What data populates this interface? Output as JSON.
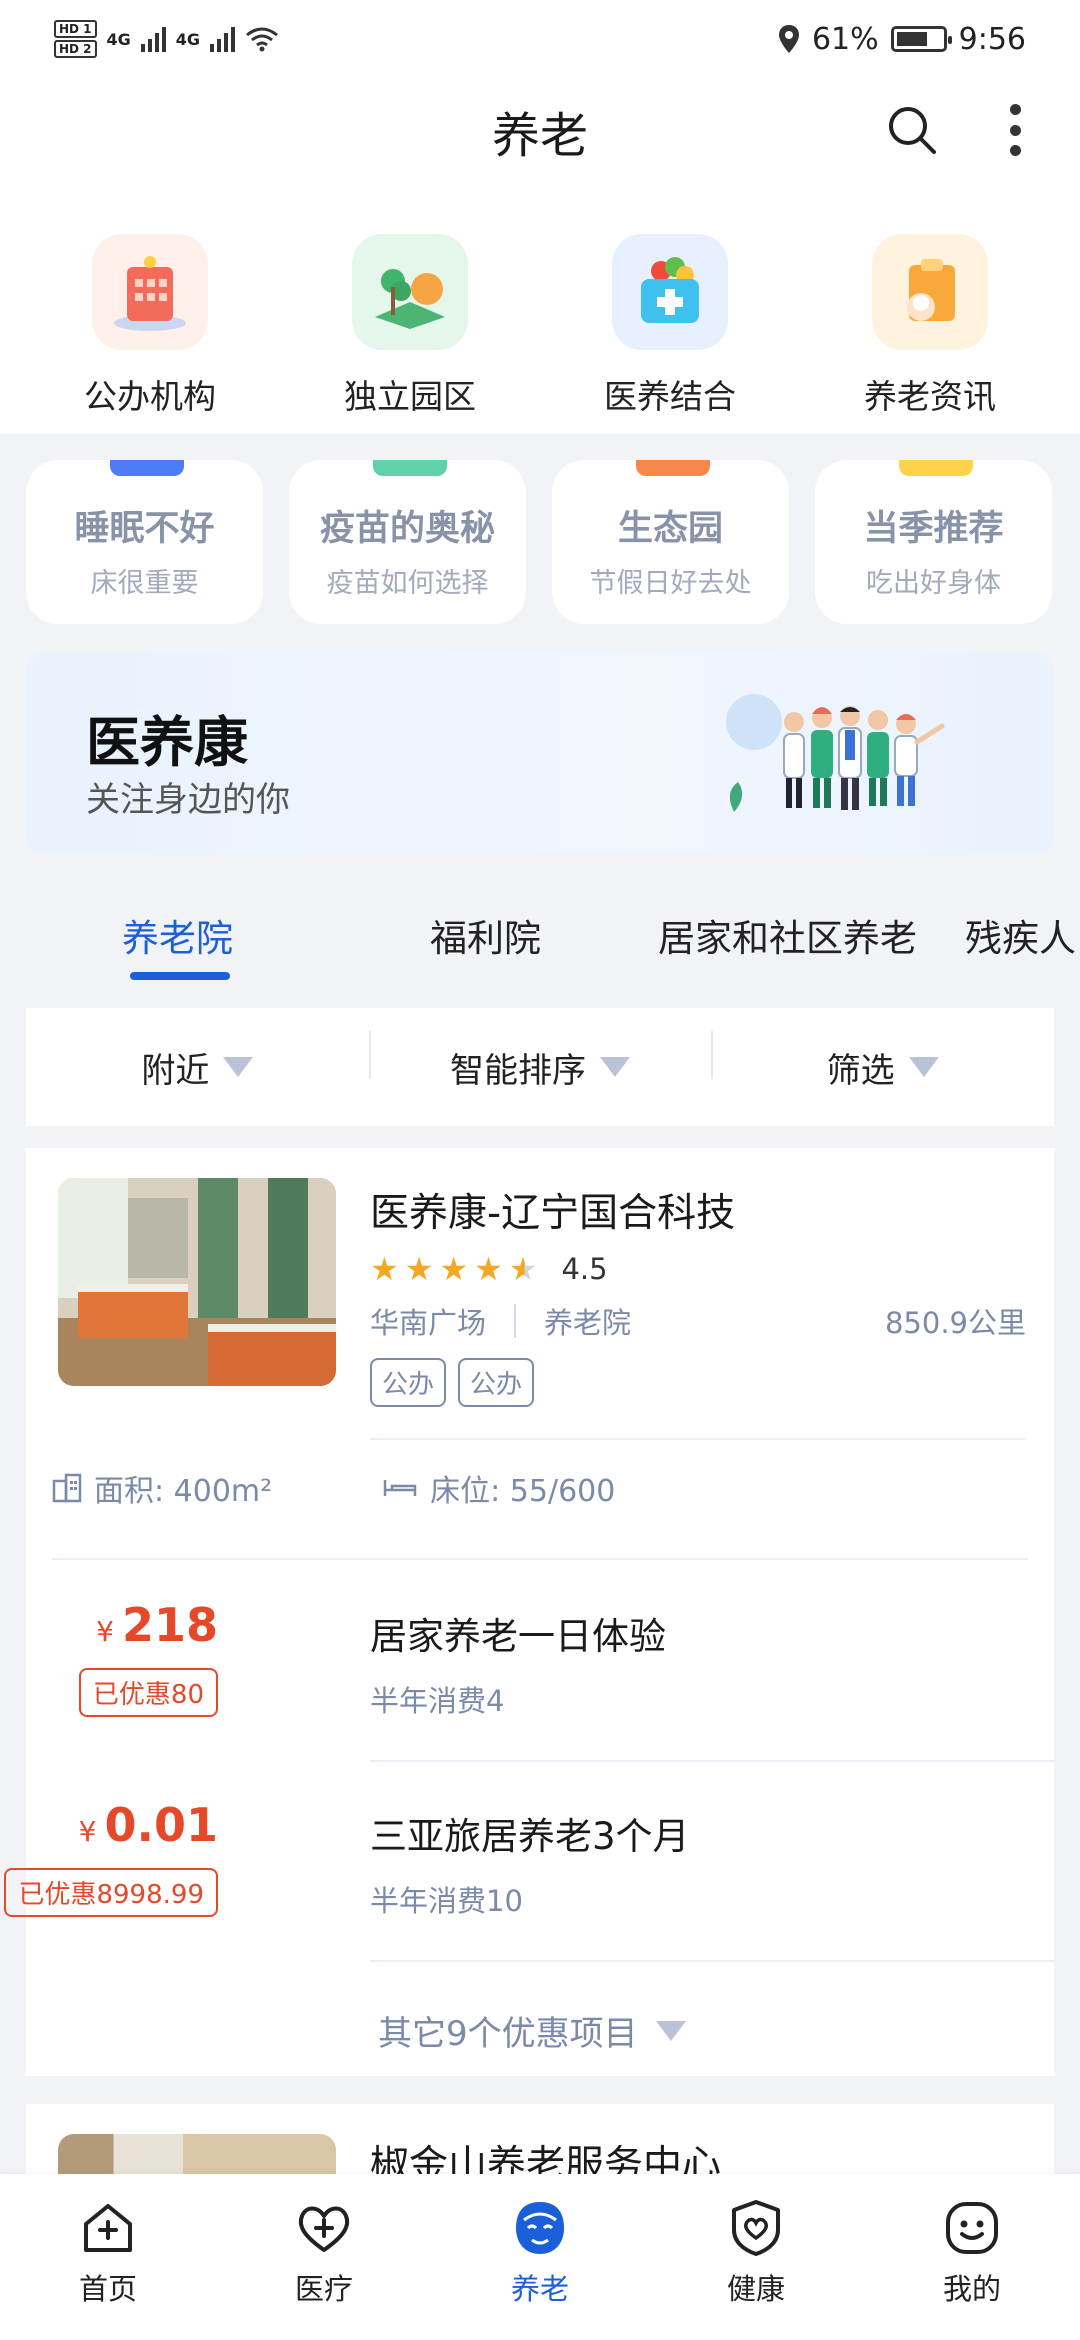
{
  "status_bar": {
    "sim1": "HD 1",
    "sim2": "HD 2",
    "net1": "4G",
    "net2": "4G",
    "battery": "61%",
    "time": "9:56"
  },
  "header": {
    "title": "养老"
  },
  "categories": [
    {
      "label": "公办机构",
      "icon": "building-icon"
    },
    {
      "label": "独立园区",
      "icon": "park-icon"
    },
    {
      "label": "医养结合",
      "icon": "medical-kit-icon"
    },
    {
      "label": "养老资讯",
      "icon": "news-icon"
    }
  ],
  "tips": [
    {
      "title": "睡眠不好",
      "sub": "床很重要",
      "color": "#4e7cf6"
    },
    {
      "title": "疫苗的奥秘",
      "sub": "疫苗如何选择",
      "color": "#5fd0a8"
    },
    {
      "title": "生态园",
      "sub": "节假日好去处",
      "color": "#f7884a"
    },
    {
      "title": "当季推荐",
      "sub": "吃出好身体",
      "color": "#ffd24a"
    }
  ],
  "banner": {
    "title": "医养康",
    "subtitle": "关注身边的你"
  },
  "tabs": [
    "养老院",
    "福利院",
    "居家和社区养老",
    "残疾人"
  ],
  "active_tab": 0,
  "filters": [
    "附近",
    "智能排序",
    "筛选"
  ],
  "listing": {
    "name": "医养康-辽宁国合科技",
    "rating": "4.5",
    "rating_value": 4.5,
    "location": "华南广场",
    "type": "养老院",
    "distance": "850.9公里",
    "tags": [
      "公办",
      "公办"
    ],
    "area": "面积: 400m²",
    "beds": "床位: 55/600",
    "offers": [
      {
        "price": "218",
        "currency": "¥",
        "discount": "已优惠80",
        "name": "居家养老一日体验",
        "sub": "半年消费4"
      },
      {
        "price": "0.01",
        "currency": "¥",
        "discount": "已优惠8998.99",
        "name": "三亚旅居养老3个月",
        "sub": "半年消费10"
      }
    ],
    "more": "其它9个优惠项目"
  },
  "next_listing": {
    "name": "椒金山养老服务中心"
  },
  "bottom_nav": [
    {
      "label": "首页",
      "icon": "home-icon"
    },
    {
      "label": "医疗",
      "icon": "heart-plus-icon"
    },
    {
      "label": "养老",
      "icon": "elder-face-icon"
    },
    {
      "label": "健康",
      "icon": "shield-heart-icon"
    },
    {
      "label": "我的",
      "icon": "smile-icon"
    }
  ],
  "colors": {
    "accent": "#1b5fd9",
    "price": "#e5492a",
    "muted": "#7b8aa8"
  }
}
